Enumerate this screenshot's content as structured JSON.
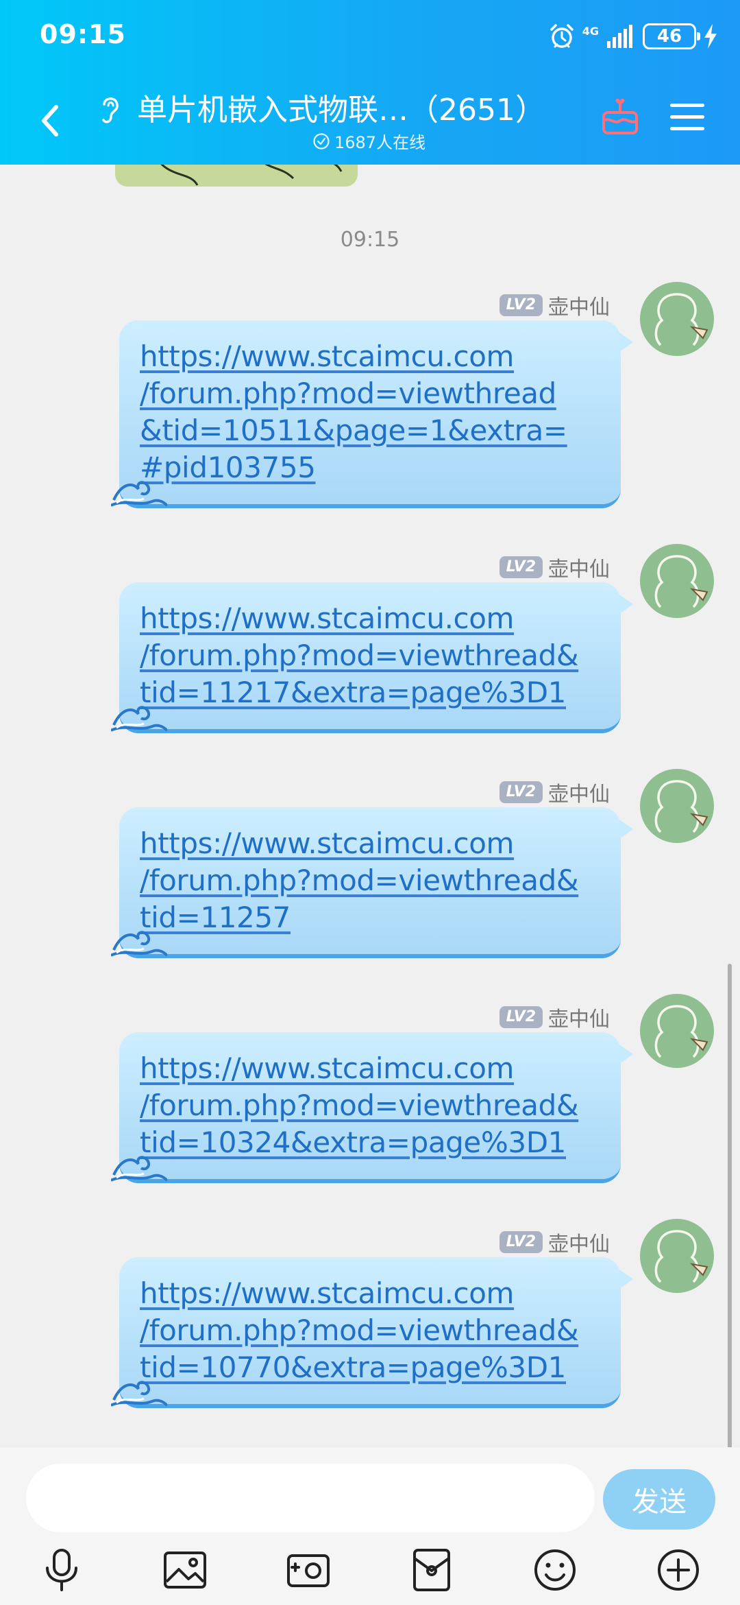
{
  "status_bar": {
    "time": "09:15",
    "network": "4G",
    "battery": "46"
  },
  "nav": {
    "title": "单片机嵌入式物联…（2651）",
    "online": "1687人在线"
  },
  "chat": {
    "time_separator": "09:15",
    "messages": [
      {
        "level": "LV2",
        "sender": "壶中仙",
        "text": "https://www.stcaimcu.com\n/forum.php?mod=viewthread\n&tid=10511&page=1&extra=\n#pid103755"
      },
      {
        "level": "LV2",
        "sender": "壶中仙",
        "text": "https://www.stcaimcu.com\n/forum.php?mod=viewthread&\ntid=11217&extra=page%3D1"
      },
      {
        "level": "LV2",
        "sender": "壶中仙",
        "text": "https://www.stcaimcu.com\n/forum.php?mod=viewthread&\ntid=11257"
      },
      {
        "level": "LV2",
        "sender": "壶中仙",
        "text": "https://www.stcaimcu.com\n/forum.php?mod=viewthread&\ntid=10324&extra=page%3D1"
      },
      {
        "level": "LV2",
        "sender": "壶中仙",
        "text": "https://www.stcaimcu.com\n/forum.php?mod=viewthread&\ntid=10770&extra=page%3D1"
      }
    ]
  },
  "input": {
    "value": "",
    "placeholder": "",
    "send_label": "发送"
  },
  "toolbar_icons": [
    "microphone-icon",
    "image-icon",
    "camera-icon",
    "red-packet-icon",
    "emoji-icon",
    "plus-icon"
  ],
  "colors": {
    "header_start": "#00c8f8",
    "header_end": "#1d9af6",
    "bubble": "#b6e0fa",
    "link_text": "#1f6fc6",
    "send_button": "#8fd0f5",
    "gift_icon": "#ff6f7a"
  }
}
